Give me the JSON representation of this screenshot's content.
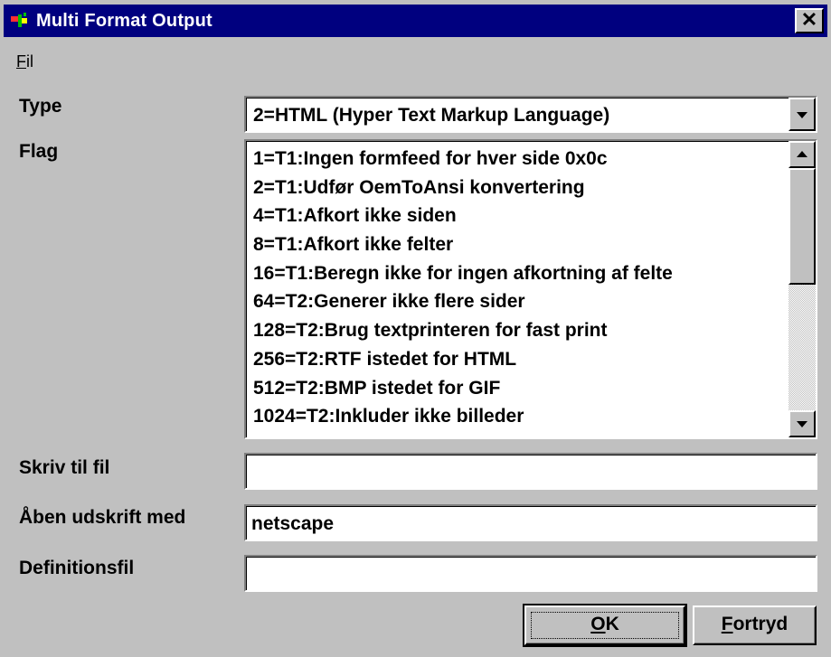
{
  "window": {
    "title": "Multi Format Output"
  },
  "menu": {
    "items": [
      {
        "mnemonic": "F",
        "rest": "il"
      }
    ]
  },
  "form": {
    "type_label": "Type",
    "type_value": "2=HTML (Hyper Text Markup Language)",
    "flag_label": "Flag",
    "flag_items": [
      "1=T1:Ingen formfeed for hver side 0x0c",
      "2=T1:Udfør OemToAnsi konvertering",
      "4=T1:Afkort ikke siden",
      "8=T1:Afkort ikke felter",
      "16=T1:Beregn ikke for ingen afkortning af felte",
      "64=T2:Generer ikke flere sider",
      "128=T2:Brug textprinteren for fast print",
      "256=T2:RTF istedet for HTML",
      "512=T2:BMP istedet for GIF",
      "1024=T2:Inkluder ikke billeder"
    ],
    "write_label": "Skriv til fil",
    "write_value": "",
    "open_label": "Åben udskrift med",
    "open_value": "netscape",
    "def_label": "Definitionsfil",
    "def_value": ""
  },
  "buttons": {
    "ok_mnemonic": "O",
    "ok_rest": "K",
    "cancel_mnemonic": "F",
    "cancel_rest": "ortryd"
  },
  "icons": {
    "app": "app-icon",
    "close": "close-icon",
    "dropdown": "chevron-down-icon",
    "scroll_up": "arrow-up-icon",
    "scroll_down": "arrow-down-icon"
  },
  "colors": {
    "titlebar": "#00007f",
    "face": "#c0c0c0"
  },
  "scroll": {
    "position": 0,
    "visible_fraction": 0.48
  }
}
